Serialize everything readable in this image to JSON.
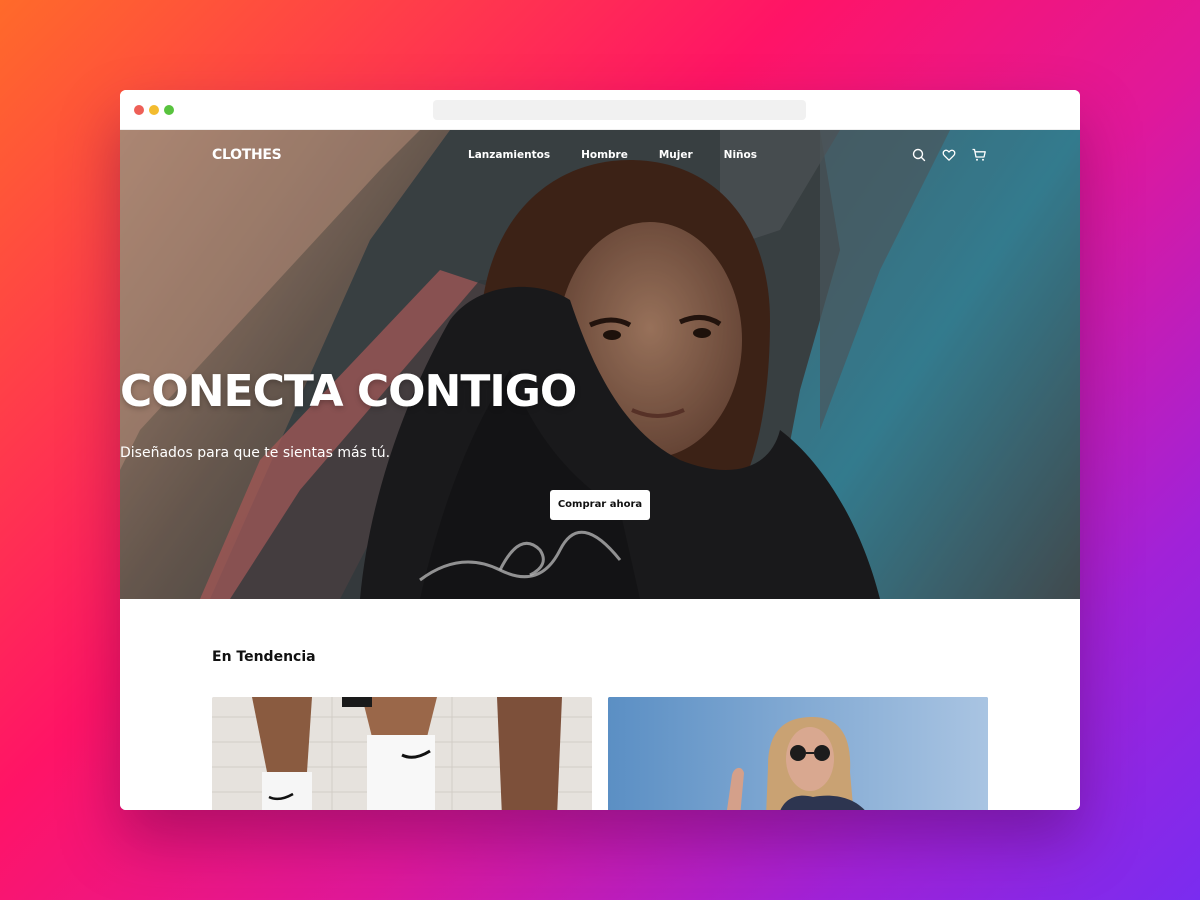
{
  "brand": {
    "logo": "CLOTHES"
  },
  "nav": {
    "links": [
      "Lanzamientos",
      "Hombre",
      "Mujer",
      "Niños"
    ],
    "icons": [
      "search-icon",
      "heart-icon",
      "cart-icon"
    ]
  },
  "hero": {
    "title": "CONECTA CONTIGO",
    "subtitle": "Diseñados para que te sientas más tú.",
    "cta_label": "Comprar ahora"
  },
  "trending": {
    "title": "En Tendencia"
  },
  "colors": {
    "background_gradient_start": "#ff6a2a",
    "background_gradient_end": "#7a2cf0",
    "cta_background": "#ffffff",
    "text_dark": "#111111"
  }
}
